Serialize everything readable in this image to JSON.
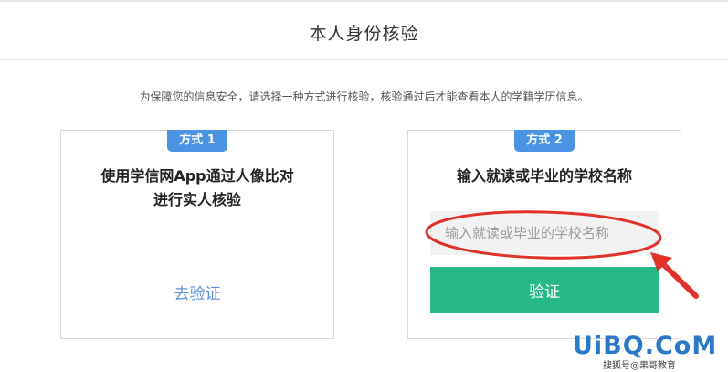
{
  "header": {
    "title": "本人身份核验"
  },
  "notice": "为保障您的信息安全，请选择一种方式进行核验，核验通过后才能查看本人的学籍学历信息。",
  "method1": {
    "badge": "方式 1",
    "title_line1": "使用学信网App通过人像比对",
    "title_line2": "进行实人核验",
    "link": "去验证"
  },
  "method2": {
    "badge": "方式 2",
    "title": "输入就读或毕业的学校名称",
    "input_placeholder": "输入就读或毕业的学校名称",
    "input_value": "",
    "button": "验证"
  },
  "watermark": {
    "brand": "UiBQ.CoM",
    "sub": "搜狐号@果哥教育"
  },
  "colors": {
    "badge": "#4b93e3",
    "button": "#26b986",
    "link": "#5b8fd1",
    "annotation": "#e0312a"
  }
}
